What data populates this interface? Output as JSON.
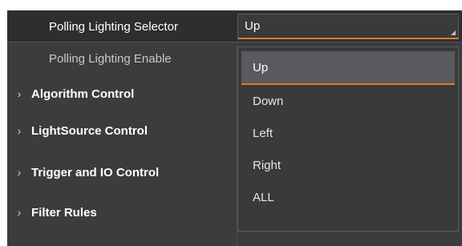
{
  "properties": [
    {
      "label": "Polling Lighting Selector",
      "value": "Up"
    },
    {
      "label": "Polling Lighting Enable"
    }
  ],
  "categories": [
    {
      "label": "Algorithm Control",
      "icon": "chevron-right-icon"
    },
    {
      "label": "LightSource Control",
      "icon": "chevron-right-icon"
    },
    {
      "label": "Trigger and IO Control",
      "icon": "chevron-right-icon"
    },
    {
      "label": "Filter Rules",
      "icon": "chevron-right-icon"
    }
  ],
  "dropdown": {
    "selected": "Up",
    "options": [
      "Up",
      "Down",
      "Left",
      "Right",
      "ALL"
    ]
  },
  "colors": {
    "panel_bg": "#3c3c3f",
    "accent": "#e07a1f",
    "text": "#ffffff"
  }
}
